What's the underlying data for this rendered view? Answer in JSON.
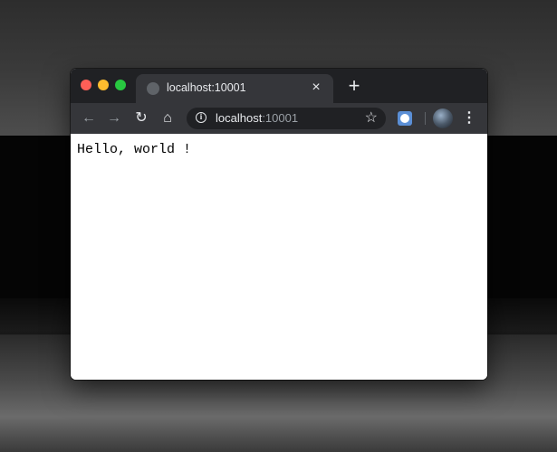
{
  "tab": {
    "title": "localhost:10001",
    "close_glyph": "×"
  },
  "new_tab_glyph": "+",
  "toolbar": {
    "back_glyph": "←",
    "forward_glyph": "→",
    "reload_glyph": "↻",
    "home_glyph": "⌂"
  },
  "omnibox": {
    "host": "localhost",
    "port": ":10001",
    "star_glyph": "☆"
  },
  "menu_glyph": "⋮",
  "page": {
    "text": "Hello, world !"
  },
  "icons": [
    "globe-icon",
    "info-icon",
    "star-icon",
    "extension-icon",
    "avatar",
    "menu-icon"
  ],
  "colors": {
    "tabstrip": "#202124",
    "active_tab": "#35363a",
    "close_light": "#fe5f57",
    "minimize_light": "#febc2e",
    "maximize_light": "#28c840"
  }
}
